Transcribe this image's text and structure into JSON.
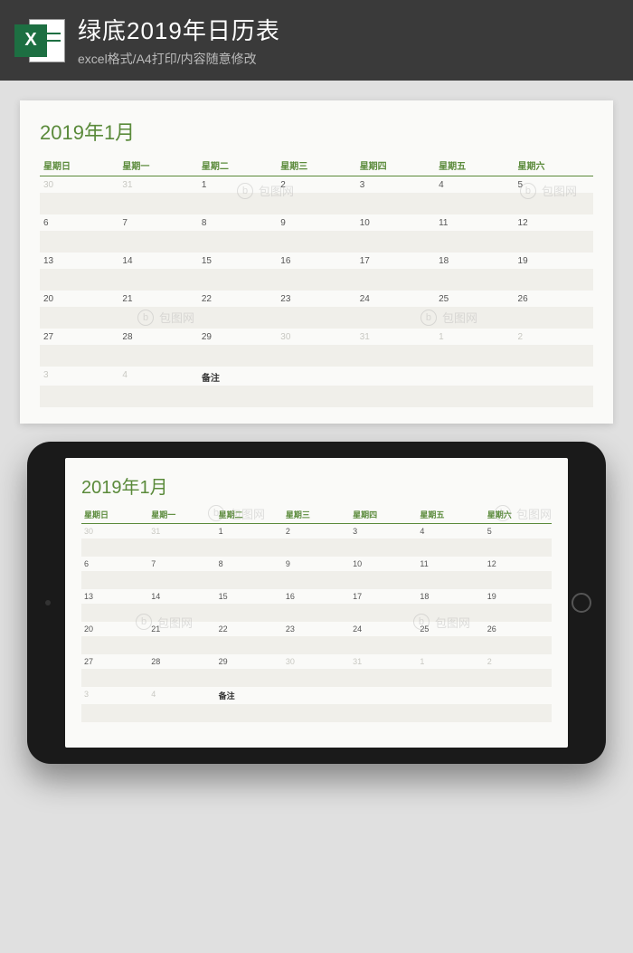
{
  "header": {
    "excel_letter": "X",
    "title": "绿底2019年日历表",
    "subtitle": "excel格式/A4打印/内容随意修改"
  },
  "calendar": {
    "title": "2019年1月",
    "weekdays": [
      "星期日",
      "星期一",
      "星期二",
      "星期三",
      "星期四",
      "星期五",
      "星期六"
    ],
    "weeks": [
      [
        {
          "d": "30",
          "fade": true
        },
        {
          "d": "31",
          "fade": true
        },
        {
          "d": "1"
        },
        {
          "d": "2"
        },
        {
          "d": "3"
        },
        {
          "d": "4"
        },
        {
          "d": "5"
        }
      ],
      [
        {
          "d": "6"
        },
        {
          "d": "7"
        },
        {
          "d": "8"
        },
        {
          "d": "9"
        },
        {
          "d": "10"
        },
        {
          "d": "11"
        },
        {
          "d": "12"
        }
      ],
      [
        {
          "d": "13"
        },
        {
          "d": "14"
        },
        {
          "d": "15"
        },
        {
          "d": "16"
        },
        {
          "d": "17"
        },
        {
          "d": "18"
        },
        {
          "d": "19"
        }
      ],
      [
        {
          "d": "20"
        },
        {
          "d": "21"
        },
        {
          "d": "22"
        },
        {
          "d": "23"
        },
        {
          "d": "24"
        },
        {
          "d": "25"
        },
        {
          "d": "26"
        }
      ],
      [
        {
          "d": "27"
        },
        {
          "d": "28"
        },
        {
          "d": "29"
        },
        {
          "d": "30",
          "fade": true
        },
        {
          "d": "31",
          "fade": true
        },
        {
          "d": "1",
          "fade": true
        },
        {
          "d": "2",
          "fade": true
        }
      ],
      [
        {
          "d": "3",
          "fade": true
        },
        {
          "d": "4",
          "fade": true
        },
        {
          "d": "备注",
          "note": true
        },
        {
          "d": ""
        },
        {
          "d": ""
        },
        {
          "d": ""
        },
        {
          "d": ""
        }
      ]
    ]
  },
  "watermark_text": "包图网"
}
